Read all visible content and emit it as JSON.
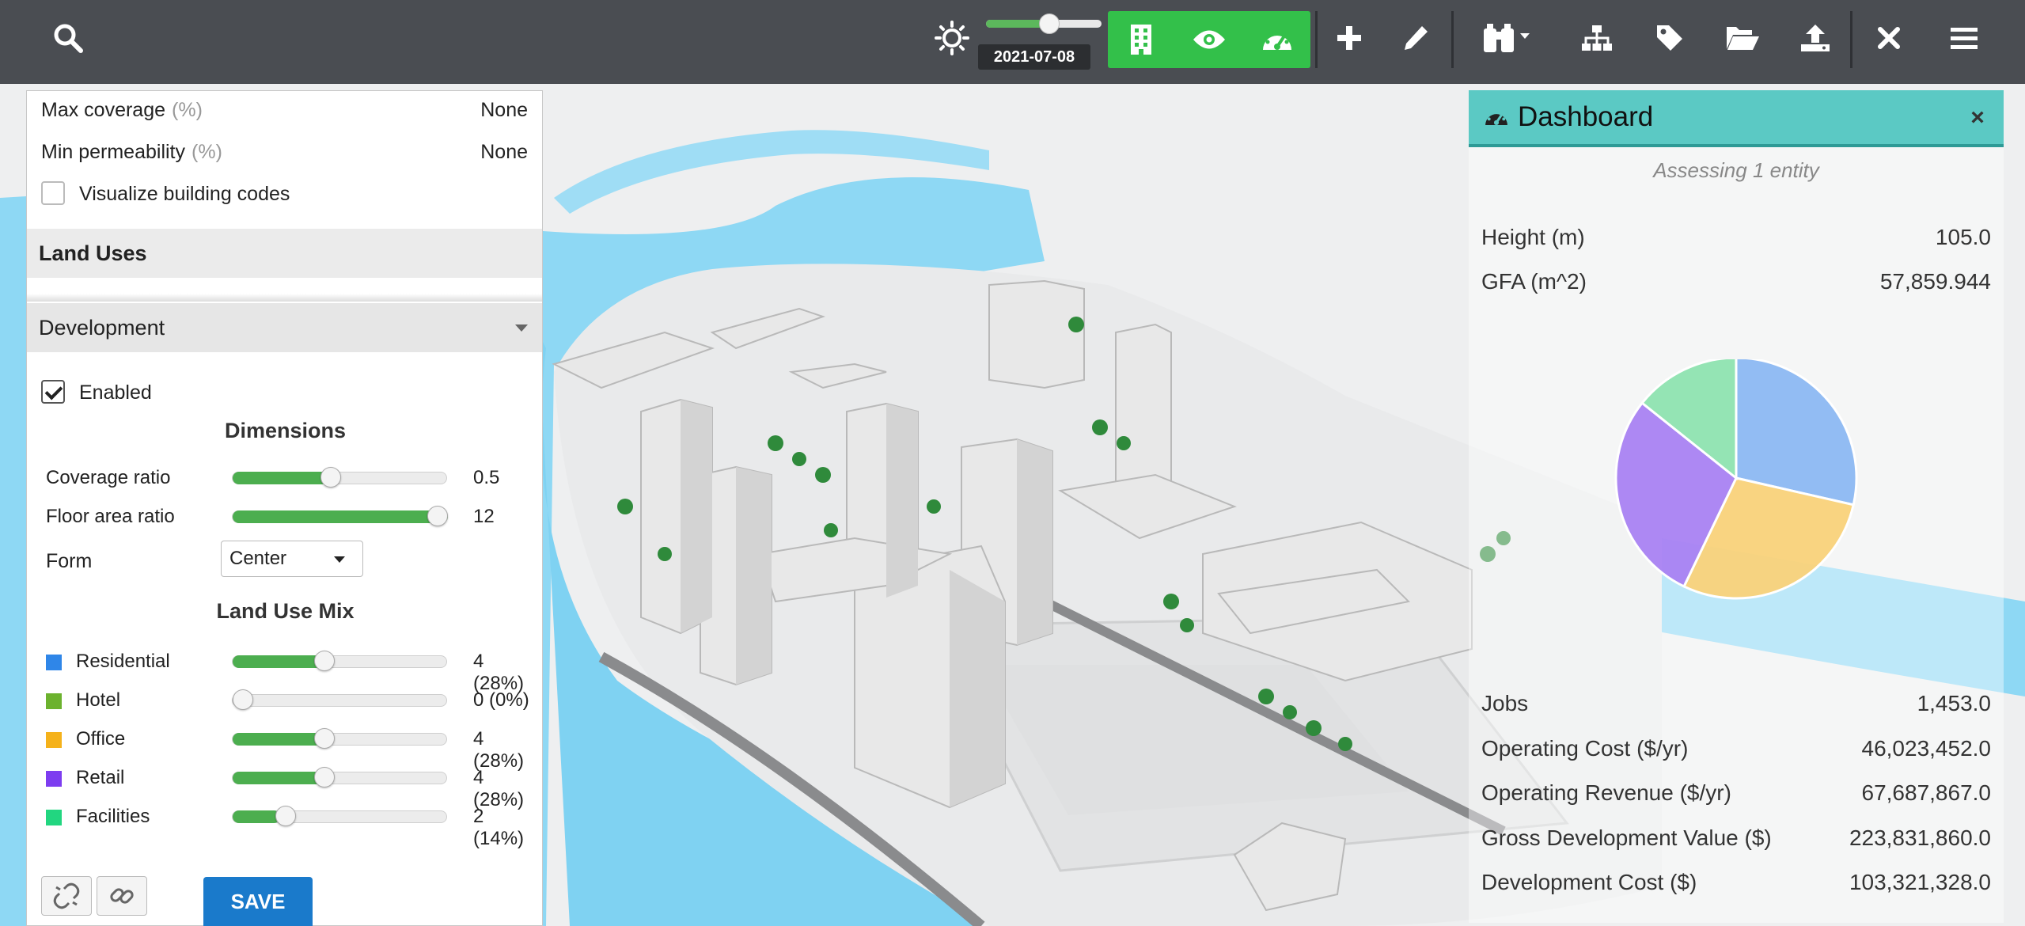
{
  "topbar": {
    "date": "2021-07-08",
    "icons": {
      "search": "search-icon",
      "brightness": "sun-icon",
      "building": "building-icon",
      "eye": "eye-icon",
      "dashboard": "dashboard-gauge-icon",
      "add": "plus-icon",
      "edit": "pencil-icon",
      "binoculars": "binoculars-icon",
      "hierarchy": "sitemap-icon",
      "tag": "tag-icon",
      "open": "folder-open-icon",
      "upload": "upload-icon",
      "close": "close-icon",
      "menu": "hamburger-menu-icon"
    },
    "date_slider_fraction": 0.55,
    "active_group_color": "#33c04a"
  },
  "left_panel": {
    "max_coverage": {
      "label": "Max coverage",
      "unit": "(%)",
      "value": "None"
    },
    "min_permeability": {
      "label": "Min permeability",
      "unit": "(%)",
      "value": "None"
    },
    "visualize_codes": {
      "label": "Visualize building codes",
      "checked": false
    },
    "land_uses_title": "Land Uses",
    "development": {
      "title": "Development",
      "enabled_label": "Enabled",
      "enabled": true,
      "dimensions_title": "Dimensions",
      "coverage": {
        "label": "Coverage ratio",
        "value": "0.5",
        "fraction": 0.45
      },
      "far": {
        "label": "Floor area ratio",
        "value": "12",
        "fraction": 1.0
      },
      "form": {
        "label": "Form",
        "selected": "Center"
      },
      "mix_title": "Land Use Mix",
      "mix": [
        {
          "label": "Residential",
          "value": "4 (28%)",
          "color": "#2f86e8",
          "fraction": 0.42
        },
        {
          "label": "Hotel",
          "value": "0 (0%)",
          "color": "#6cb22e",
          "fraction": 0.0
        },
        {
          "label": "Office",
          "value": "4 (28%)",
          "color": "#f5b21b",
          "fraction": 0.42
        },
        {
          "label": "Retail",
          "value": "4 (28%)",
          "color": "#7d3df0",
          "fraction": 0.42
        },
        {
          "label": "Facilities",
          "value": "2 (14%)",
          "color": "#22d680",
          "fraction": 0.22
        }
      ]
    },
    "save_label": "SAVE",
    "icons": {
      "unlink": "unlink-icon",
      "link": "link-icon"
    }
  },
  "dashboard": {
    "title": "Dashboard",
    "subtitle": "Assessing 1 entity",
    "height": {
      "label": "Height (m)",
      "value": "105.0"
    },
    "gfa": {
      "label": "GFA (m^2)",
      "value": "57,859.944"
    },
    "pie": [
      {
        "value": 28,
        "color": "#8cb8f2"
      },
      {
        "value": 28,
        "color": "#f9d27a"
      },
      {
        "value": 28,
        "color": "#a982f2"
      },
      {
        "value": 14,
        "color": "#8ee3b0"
      }
    ],
    "stats": [
      {
        "label": "Jobs",
        "value": "1,453.0"
      },
      {
        "label": "Operating Cost ($/yr)",
        "value": "46,023,452.0"
      },
      {
        "label": "Operating Revenue ($/yr)",
        "value": "67,687,867.0"
      },
      {
        "label": "Gross Development Value ($)",
        "value": "223,831,860.0"
      },
      {
        "label": "Development Cost ($)",
        "value": "103,321,328.0"
      }
    ]
  }
}
